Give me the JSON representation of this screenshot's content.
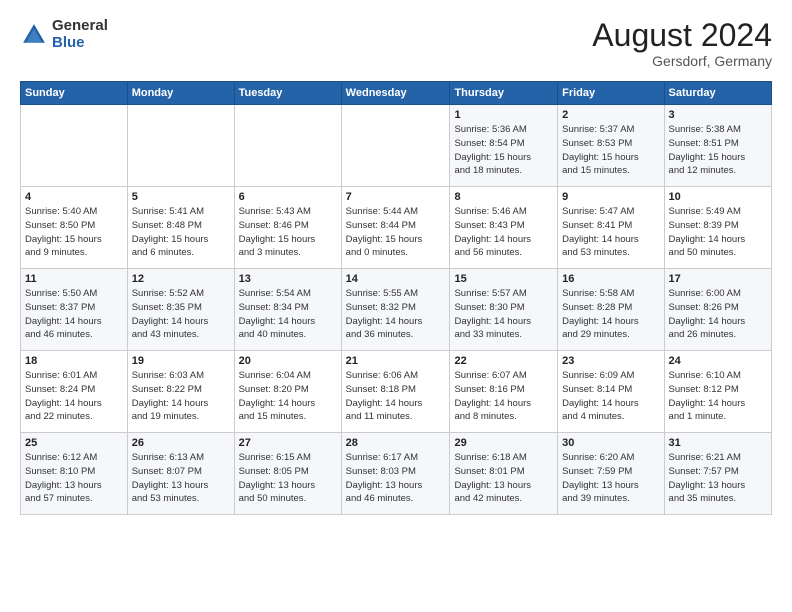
{
  "header": {
    "logo_general": "General",
    "logo_blue": "Blue",
    "month_year": "August 2024",
    "location": "Gersdorf, Germany"
  },
  "weekdays": [
    "Sunday",
    "Monday",
    "Tuesday",
    "Wednesday",
    "Thursday",
    "Friday",
    "Saturday"
  ],
  "weeks": [
    [
      {
        "day": "",
        "info": ""
      },
      {
        "day": "",
        "info": ""
      },
      {
        "day": "",
        "info": ""
      },
      {
        "day": "",
        "info": ""
      },
      {
        "day": "1",
        "info": "Sunrise: 5:36 AM\nSunset: 8:54 PM\nDaylight: 15 hours\nand 18 minutes."
      },
      {
        "day": "2",
        "info": "Sunrise: 5:37 AM\nSunset: 8:53 PM\nDaylight: 15 hours\nand 15 minutes."
      },
      {
        "day": "3",
        "info": "Sunrise: 5:38 AM\nSunset: 8:51 PM\nDaylight: 15 hours\nand 12 minutes."
      }
    ],
    [
      {
        "day": "4",
        "info": "Sunrise: 5:40 AM\nSunset: 8:50 PM\nDaylight: 15 hours\nand 9 minutes."
      },
      {
        "day": "5",
        "info": "Sunrise: 5:41 AM\nSunset: 8:48 PM\nDaylight: 15 hours\nand 6 minutes."
      },
      {
        "day": "6",
        "info": "Sunrise: 5:43 AM\nSunset: 8:46 PM\nDaylight: 15 hours\nand 3 minutes."
      },
      {
        "day": "7",
        "info": "Sunrise: 5:44 AM\nSunset: 8:44 PM\nDaylight: 15 hours\nand 0 minutes."
      },
      {
        "day": "8",
        "info": "Sunrise: 5:46 AM\nSunset: 8:43 PM\nDaylight: 14 hours\nand 56 minutes."
      },
      {
        "day": "9",
        "info": "Sunrise: 5:47 AM\nSunset: 8:41 PM\nDaylight: 14 hours\nand 53 minutes."
      },
      {
        "day": "10",
        "info": "Sunrise: 5:49 AM\nSunset: 8:39 PM\nDaylight: 14 hours\nand 50 minutes."
      }
    ],
    [
      {
        "day": "11",
        "info": "Sunrise: 5:50 AM\nSunset: 8:37 PM\nDaylight: 14 hours\nand 46 minutes."
      },
      {
        "day": "12",
        "info": "Sunrise: 5:52 AM\nSunset: 8:35 PM\nDaylight: 14 hours\nand 43 minutes."
      },
      {
        "day": "13",
        "info": "Sunrise: 5:54 AM\nSunset: 8:34 PM\nDaylight: 14 hours\nand 40 minutes."
      },
      {
        "day": "14",
        "info": "Sunrise: 5:55 AM\nSunset: 8:32 PM\nDaylight: 14 hours\nand 36 minutes."
      },
      {
        "day": "15",
        "info": "Sunrise: 5:57 AM\nSunset: 8:30 PM\nDaylight: 14 hours\nand 33 minutes."
      },
      {
        "day": "16",
        "info": "Sunrise: 5:58 AM\nSunset: 8:28 PM\nDaylight: 14 hours\nand 29 minutes."
      },
      {
        "day": "17",
        "info": "Sunrise: 6:00 AM\nSunset: 8:26 PM\nDaylight: 14 hours\nand 26 minutes."
      }
    ],
    [
      {
        "day": "18",
        "info": "Sunrise: 6:01 AM\nSunset: 8:24 PM\nDaylight: 14 hours\nand 22 minutes."
      },
      {
        "day": "19",
        "info": "Sunrise: 6:03 AM\nSunset: 8:22 PM\nDaylight: 14 hours\nand 19 minutes."
      },
      {
        "day": "20",
        "info": "Sunrise: 6:04 AM\nSunset: 8:20 PM\nDaylight: 14 hours\nand 15 minutes."
      },
      {
        "day": "21",
        "info": "Sunrise: 6:06 AM\nSunset: 8:18 PM\nDaylight: 14 hours\nand 11 minutes."
      },
      {
        "day": "22",
        "info": "Sunrise: 6:07 AM\nSunset: 8:16 PM\nDaylight: 14 hours\nand 8 minutes."
      },
      {
        "day": "23",
        "info": "Sunrise: 6:09 AM\nSunset: 8:14 PM\nDaylight: 14 hours\nand 4 minutes."
      },
      {
        "day": "24",
        "info": "Sunrise: 6:10 AM\nSunset: 8:12 PM\nDaylight: 14 hours\nand 1 minute."
      }
    ],
    [
      {
        "day": "25",
        "info": "Sunrise: 6:12 AM\nSunset: 8:10 PM\nDaylight: 13 hours\nand 57 minutes."
      },
      {
        "day": "26",
        "info": "Sunrise: 6:13 AM\nSunset: 8:07 PM\nDaylight: 13 hours\nand 53 minutes."
      },
      {
        "day": "27",
        "info": "Sunrise: 6:15 AM\nSunset: 8:05 PM\nDaylight: 13 hours\nand 50 minutes."
      },
      {
        "day": "28",
        "info": "Sunrise: 6:17 AM\nSunset: 8:03 PM\nDaylight: 13 hours\nand 46 minutes."
      },
      {
        "day": "29",
        "info": "Sunrise: 6:18 AM\nSunset: 8:01 PM\nDaylight: 13 hours\nand 42 minutes."
      },
      {
        "day": "30",
        "info": "Sunrise: 6:20 AM\nSunset: 7:59 PM\nDaylight: 13 hours\nand 39 minutes."
      },
      {
        "day": "31",
        "info": "Sunrise: 6:21 AM\nSunset: 7:57 PM\nDaylight: 13 hours\nand 35 minutes."
      }
    ]
  ]
}
